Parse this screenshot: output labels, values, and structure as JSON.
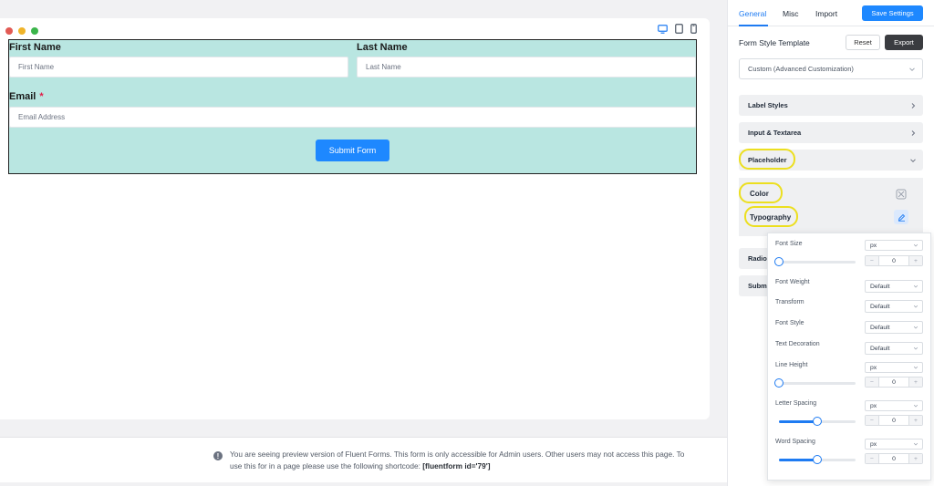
{
  "preview": {
    "window_dots": [
      "#e25a54",
      "#f0b429",
      "#3bb54a"
    ],
    "devices": [
      "desktop-icon",
      "tablet-icon",
      "mobile-icon"
    ]
  },
  "form": {
    "first_name_label": "First Name",
    "first_name_placeholder": "First Name",
    "last_name_label": "Last Name",
    "last_name_placeholder": "Last Name",
    "email_label": "Email",
    "email_required_mark": "*",
    "email_placeholder": "Email Address",
    "submit_label": "Submit Form"
  },
  "notice": {
    "icon": "info-icon",
    "text": "You are seeing preview version of Fluent Forms. This form is only accessible for Admin users. Other users may not access this page. To use this for in a page please use the following shortcode: ",
    "shortcode": "[fluentform id='79']"
  },
  "panel": {
    "tabs": [
      "General",
      "Misc",
      "Import"
    ],
    "active_tab": "General",
    "save_label": "Save Settings",
    "template_label": "Form Style Template",
    "reset_label": "Reset",
    "export_label": "Export",
    "template_value": "Custom (Advanced Customization)",
    "sections": {
      "label_styles": "Label Styles",
      "input_textarea": "Input & Textarea",
      "placeholder": "Placeholder",
      "radio_partial": "Radio",
      "submit_partial": "Subm"
    },
    "placeholder_items": {
      "color": "Color",
      "typography": "Typography"
    },
    "highlight_color": "#ecdf1f"
  },
  "typography": {
    "font_size": {
      "label": "Font Size",
      "unit": "px",
      "value": "0",
      "slider": 0.0
    },
    "font_weight": {
      "label": "Font Weight",
      "value": "Default"
    },
    "transform": {
      "label": "Transform",
      "value": "Default"
    },
    "font_style": {
      "label": "Font Style",
      "value": "Default"
    },
    "text_decoration": {
      "label": "Text Decoration",
      "value": "Default"
    },
    "line_height": {
      "label": "Line Height",
      "unit": "px",
      "value": "0",
      "slider": 0.0
    },
    "letter_spacing": {
      "label": "Letter Spacing",
      "unit": "px",
      "value": "0",
      "slider": 0.5
    },
    "word_spacing": {
      "label": "Word Spacing",
      "unit": "px",
      "value": "0",
      "slider": 0.5
    },
    "minus": "−",
    "plus": "+"
  }
}
